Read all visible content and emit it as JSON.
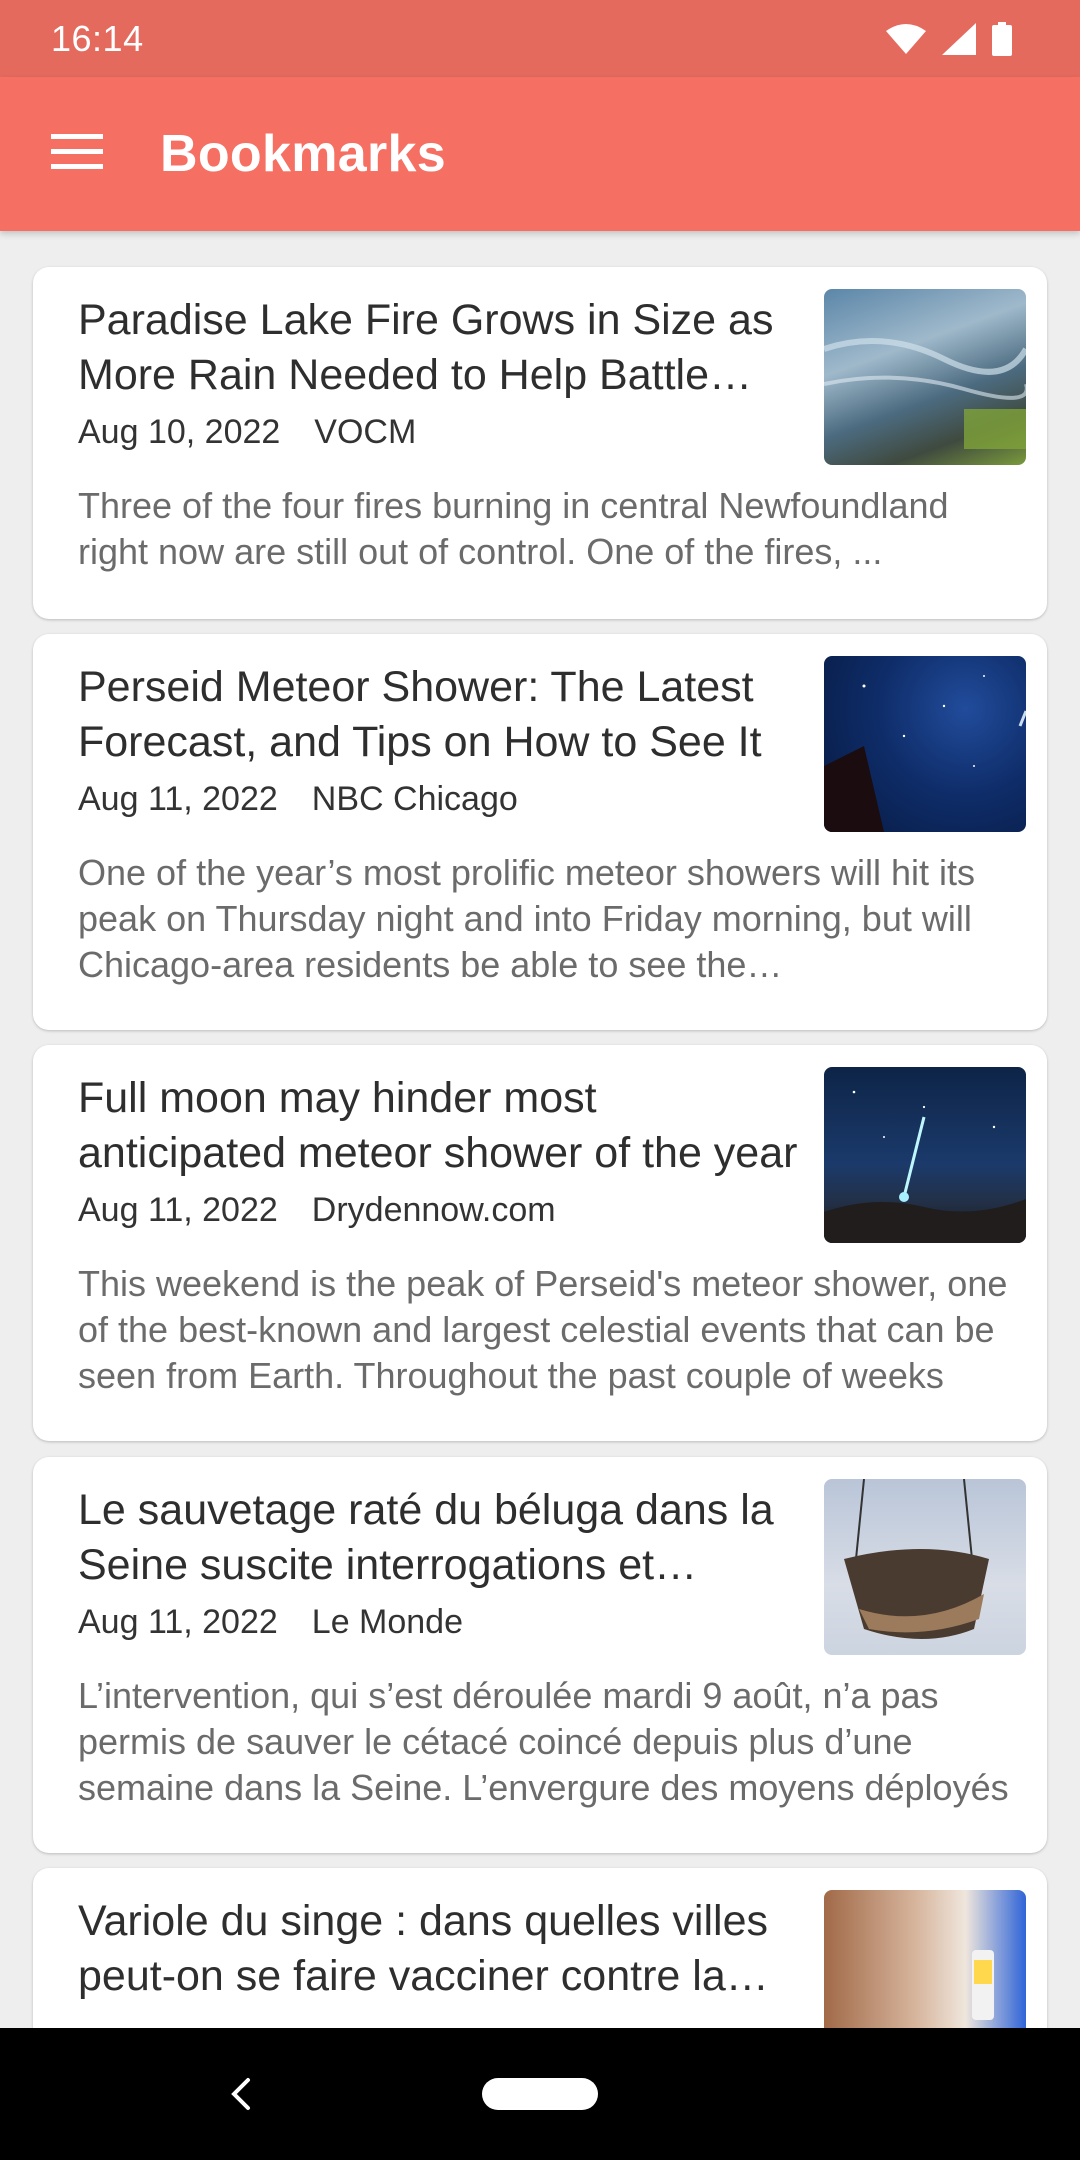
{
  "status_bar": {
    "time": "16:14",
    "icons": [
      "wifi-icon",
      "signal-icon",
      "battery-icon"
    ]
  },
  "app_bar": {
    "title": "Bookmarks",
    "menu_icon": "menu-icon"
  },
  "colors": {
    "status_bar": "#e46a5e",
    "app_bar": "#f56f63",
    "background": "#eeeeee",
    "card": "#ffffff"
  },
  "articles": [
    {
      "title": "Paradise Lake Fire Grows in Size as More Rain Needed to Help Battle Flames",
      "date": "Aug 10, 2022",
      "source": "VOCM",
      "summary": "Three of the four fires burning in central Newfoundland right now are still out of control. One of the fires, ..."
    },
    {
      "title": "Perseid Meteor Shower: The Latest Forecast, and Tips on How to See It",
      "date": "Aug 11, 2022",
      "source": "NBC Chicago",
      "summary": "One of the year’s most prolific meteor showers will hit its peak on Thursday night and into Friday morning, but will Chicago-area residents be able to see the…"
    },
    {
      "title": "Full moon may hinder most anticipated meteor shower of the year",
      "date": "Aug 11, 2022",
      "source": "Drydennow.com",
      "summary": "This weekend is the peak of Perseid's meteor shower, one of the best-known and largest celestial events that can be seen from Earth. Throughout the past couple of weeks"
    },
    {
      "title": "Le sauvetage raté du béluga dans la Seine suscite interrogations et critiques",
      "date": "Aug 11, 2022",
      "source": "Le Monde",
      "summary": "L’intervention, qui s’est déroulée mardi 9 août, n’a pas permis de sauver le cétacé coincé depuis plus d’une semaine dans la Seine. L’envergure des moyens déployés"
    },
    {
      "title": "Variole du singe : dans quelles villes peut-on se faire vacciner contre la maladie ?",
      "date": "",
      "source": "",
      "summary": ""
    }
  ],
  "nav_bar": {
    "back_icon": "back-icon",
    "home_icon": "home-pill-icon"
  }
}
